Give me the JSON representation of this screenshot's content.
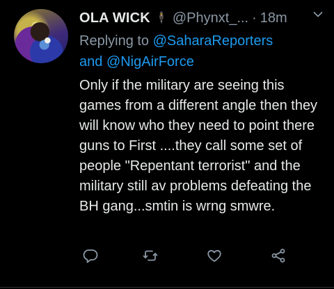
{
  "tweet": {
    "author_name": "OLA WICK",
    "author_emoji": "🕴",
    "handle": "@Phynxt_...",
    "separator": "·",
    "time": "18m",
    "replying_prefix": "Replying to",
    "replying_mentions": [
      "@SaharaReporters",
      "@NigAirForce"
    ],
    "replying_and": "and",
    "body": "Only if the military are seeing this games from a different angle then they will know who they need to point there guns to First ....they call some set of people \"Repentant terrorist\" and the military still av problems defeating the BH gang...smtin is wrng smwre."
  },
  "icons": {
    "menu": "chevron-down-icon",
    "reply": "reply-icon",
    "retweet": "retweet-icon",
    "like": "like-icon",
    "share": "share-icon"
  },
  "colors": {
    "background": "#000000",
    "text": "#e7e9ea",
    "muted": "#8b98a5",
    "link": "#1d9bf0"
  }
}
